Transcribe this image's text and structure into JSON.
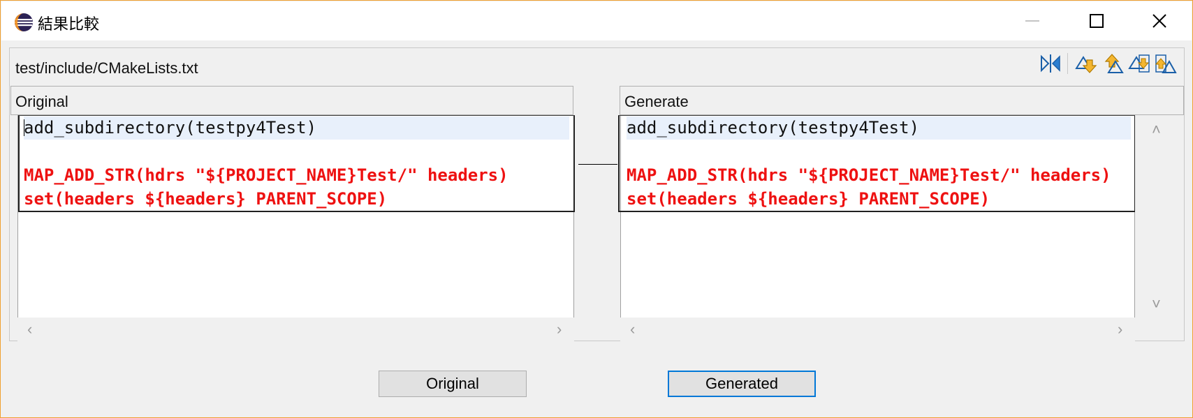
{
  "window": {
    "title": "結果比較",
    "icon": "eclipse-icon",
    "controls": [
      "minimize-icon",
      "maximize-icon",
      "close-icon"
    ]
  },
  "file": {
    "path": "test/include/CMakeLists.txt"
  },
  "toolbar": {
    "icons": [
      "swap-sides-icon",
      "next-difference-icon",
      "previous-difference-icon",
      "next-change-icon",
      "previous-change-icon"
    ]
  },
  "left_pane": {
    "header": "Original",
    "lines": [
      {
        "text": "add_subdirectory(testpy4Test)",
        "changed": false
      },
      {
        "text": "",
        "changed": false
      },
      {
        "text": "MAP_ADD_STR(hdrs \"${PROJECT_NAME}Test/\" headers)",
        "changed": true
      },
      {
        "text": "set(headers ${headers} PARENT_SCOPE)",
        "changed": true
      }
    ]
  },
  "right_pane": {
    "header": "Generate",
    "lines": [
      {
        "text": "add_subdirectory(testpy4Test)",
        "changed": false
      },
      {
        "text": "",
        "changed": false
      },
      {
        "text": "MAP_ADD_STR(hdrs \"${PROJECT_NAME}Test/\" headers)",
        "changed": true
      },
      {
        "text": "set(headers ${headers} PARENT_SCOPE)",
        "changed": true
      }
    ]
  },
  "buttons": {
    "original": "Original",
    "generated": "Generated"
  },
  "colors": {
    "changed_text": "#ee1111",
    "current_line": "#e8f0fb",
    "focus_border": "#0078d7",
    "window_border": "#f0a030"
  }
}
